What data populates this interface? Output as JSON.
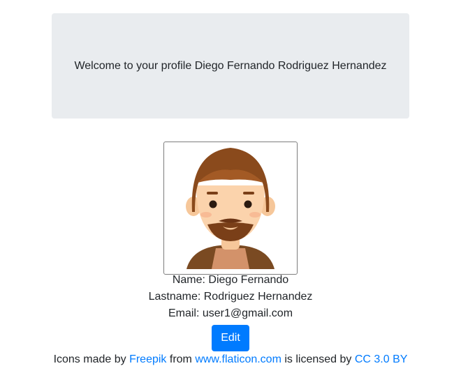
{
  "banner": {
    "welcome_text": "Welcome to your profile Diego Fernando Rodriguez Hernandez"
  },
  "profile": {
    "avatar_icon": "male-avatar-icon",
    "name_line": "Name: Diego Fernando",
    "lastname_line": "Lastname: Rodriguez Hernandez",
    "email_line": "Email: user1@gmail.com"
  },
  "actions": {
    "edit_label": "Edit"
  },
  "credits": {
    "prefix": "Icons made by ",
    "author_link": "Freepik",
    "middle": " from ",
    "site_link": "www.flaticon.com",
    "license_text": " is licensed by ",
    "license_link": "CC 3.0 BY"
  },
  "colors": {
    "banner_bg": "#e9ecef",
    "primary": "#007bff"
  }
}
